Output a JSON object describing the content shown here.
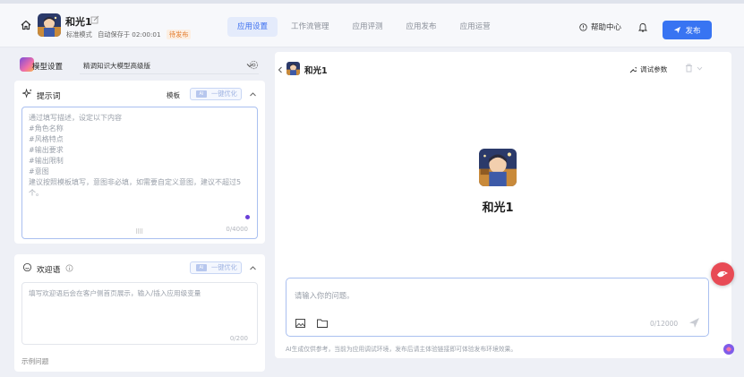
{
  "header": {
    "app_name": "和光1",
    "mode": "标准模式",
    "autosave": "自动保存于 02:00:01",
    "status": "待发布",
    "tabs": [
      {
        "label": "应用设置",
        "active": true
      },
      {
        "label": "工作流管理",
        "active": false
      },
      {
        "label": "应用评测",
        "active": false
      },
      {
        "label": "应用发布",
        "active": false
      },
      {
        "label": "应用运营",
        "active": false
      }
    ],
    "help_label": "帮助中心",
    "publish_label": "发布"
  },
  "settings": {
    "model_label": "模型设置",
    "model_value": "精调知识大模型高级版",
    "prompt": {
      "title": "提示词",
      "template_label": "模板",
      "optimize_label": "一键优化",
      "placeholder": "通过填写描述，设定以下内容\n#角色名称\n#风格特点\n#输出要求\n#输出限制\n#意图\n建议按照模板填写，意图非必填，如需要自定义意图，建议不超过5个。",
      "counter": "0/4000"
    },
    "welcome": {
      "title": "欢迎语",
      "optimize_label": "一键优化",
      "placeholder": "填写欢迎语后会在客户侧首页展示，输入/插入应用级变量",
      "counter": "0/200"
    },
    "examples_label": "示例问题"
  },
  "preview": {
    "name": "和光1",
    "debug_label": "调试参数",
    "center_name": "和光1",
    "input_placeholder": "请输入你的问题。",
    "counter": "0/12000",
    "disclaimer": "AI生成仅供参考，当前为应用调试环境，发布后请主体验链接即可体验发布环境效果。"
  },
  "colors": {
    "accent": "#3874f2",
    "tab_active_bg": "#e4ebfb",
    "status_orange": "#e37b2b",
    "float_red": "#e84b55"
  },
  "icons": [
    "home-icon",
    "edit-icon",
    "help-icon",
    "bell-icon",
    "send-icon",
    "settings-icon",
    "sparkle-icon",
    "chevron-up-icon",
    "chat-bubble-icon",
    "trash-icon",
    "image-icon",
    "folder-icon",
    "robot-icon"
  ]
}
